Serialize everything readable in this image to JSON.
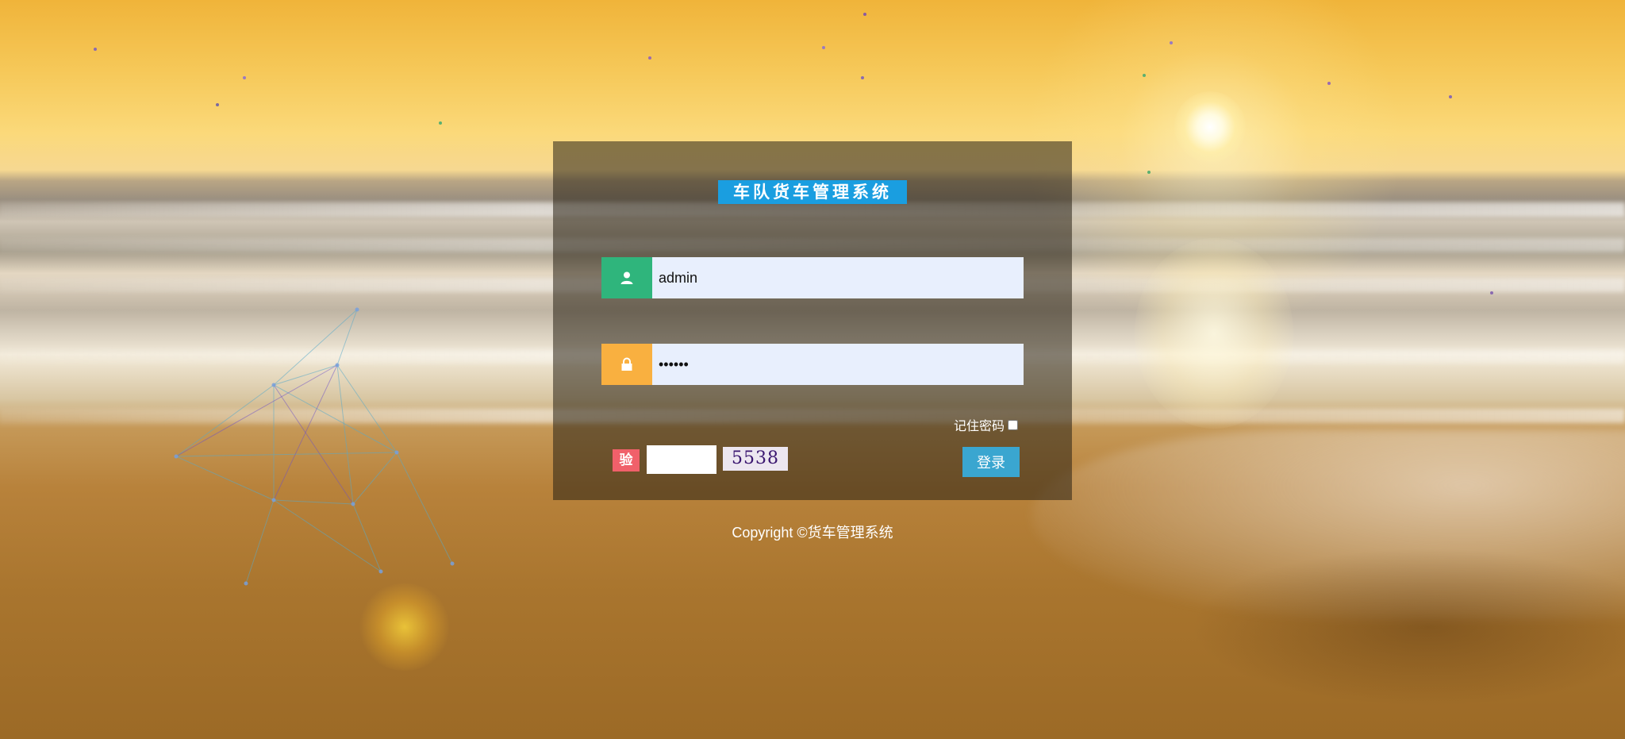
{
  "app": {
    "title": "车队货车管理系统"
  },
  "login_form": {
    "username": {
      "value": "admin",
      "icon": "user-icon"
    },
    "password": {
      "value": "123456",
      "icon": "lock-icon"
    },
    "remember": {
      "label": "记住密码",
      "checked": false
    },
    "captcha": {
      "badge": "验",
      "input_value": "",
      "code": "5538"
    },
    "submit_label": "登录"
  },
  "footer": {
    "copyright": "Copyright ©货车管理系统"
  },
  "colors": {
    "title_bg": "#1a9ee0",
    "user_icon_bg": "#2fb57c",
    "lock_icon_bg": "#f9b040",
    "captcha_badge_bg": "#f0606a",
    "login_button_bg": "#3aa6d0",
    "input_bg": "#e8effd"
  }
}
